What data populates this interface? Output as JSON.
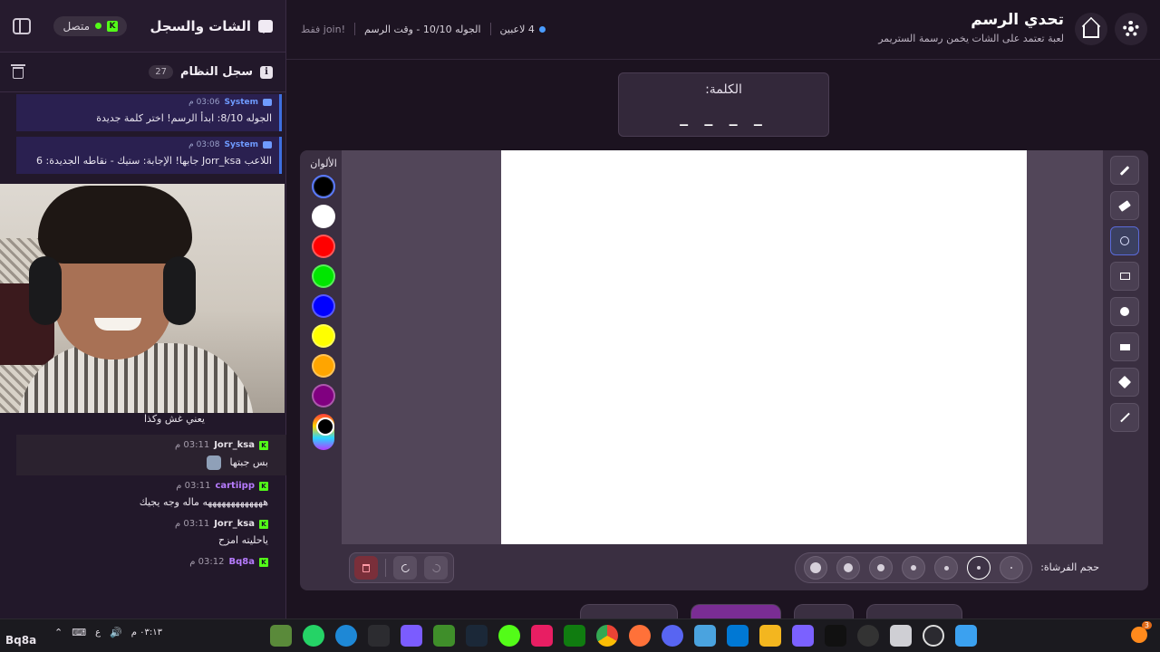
{
  "sidebar": {
    "title": "الشات والسجل",
    "status_label": "متصل",
    "platform_icon_letter": "K",
    "system_log": {
      "title": "سجل النظام",
      "count": "27",
      "messages": [
        {
          "sender": "System",
          "time": "03:06 م",
          "text": "الجوله 8/10: ابدأ الرسم! اختر كلمة جديدة"
        },
        {
          "sender": "System",
          "time": "03:08 م",
          "text": "اللاعب Jorr_ksa جابها! الإجابة: ستيك - نقاطه الجديدة: 6"
        }
      ]
    },
    "chat": {
      "fragment": "يعني غش وكذا",
      "messages": [
        {
          "user": "Jorr_ksa",
          "time": "03:11 م",
          "text": "بس جبتها",
          "user_color": "#e8e3ea",
          "highlighted": true
        },
        {
          "user": "cartiipp",
          "time": "03:11 م",
          "text": "هههههههههههههه ماله وجه يجيك",
          "user_color": "#b77cff",
          "highlighted": false
        },
        {
          "user": "Jorr_ksa",
          "time": "03:11 م",
          "text": "ياحليته امزح",
          "user_color": "#e8e3ea",
          "highlighted": false
        },
        {
          "user": "Bq8a",
          "time": "03:12 م",
          "text": "",
          "user_color": "#b77cff",
          "highlighted": false
        }
      ]
    }
  },
  "header": {
    "title": "تحدي الرسم",
    "subtitle": "لعبة تعتمد على الشات يخمن رسمة الستريمر",
    "players": "4 لاعبين",
    "round": "الجوله 10/10 - وقت الرسم",
    "join_hint": "!join فقط"
  },
  "word": {
    "label": "الكلمة:",
    "blanks": "_ _ _ _"
  },
  "palette": {
    "label": "الألوان",
    "colors": [
      "#000000",
      "#ffffff",
      "#ff0000",
      "#00e600",
      "#0000ff",
      "#ffff00",
      "#ffa500",
      "#800080"
    ],
    "active_color": "#000000"
  },
  "tools": {
    "items": [
      "pencil-icon",
      "eraser-icon",
      "circle-outline-icon",
      "rectangle-outline-icon",
      "filled-circle-icon",
      "filled-rectangle-icon",
      "fill-bucket-icon",
      "line-icon"
    ],
    "active": "circle-outline-icon"
  },
  "brush": {
    "label": "حجم الفرشاة:",
    "sizes": [
      2,
      4,
      5,
      6,
      8,
      10,
      12
    ],
    "active_size": 4
  },
  "taskbar": {
    "user": "Bq8a",
    "time": "٠٣:١٣ م",
    "lang": "ع"
  }
}
